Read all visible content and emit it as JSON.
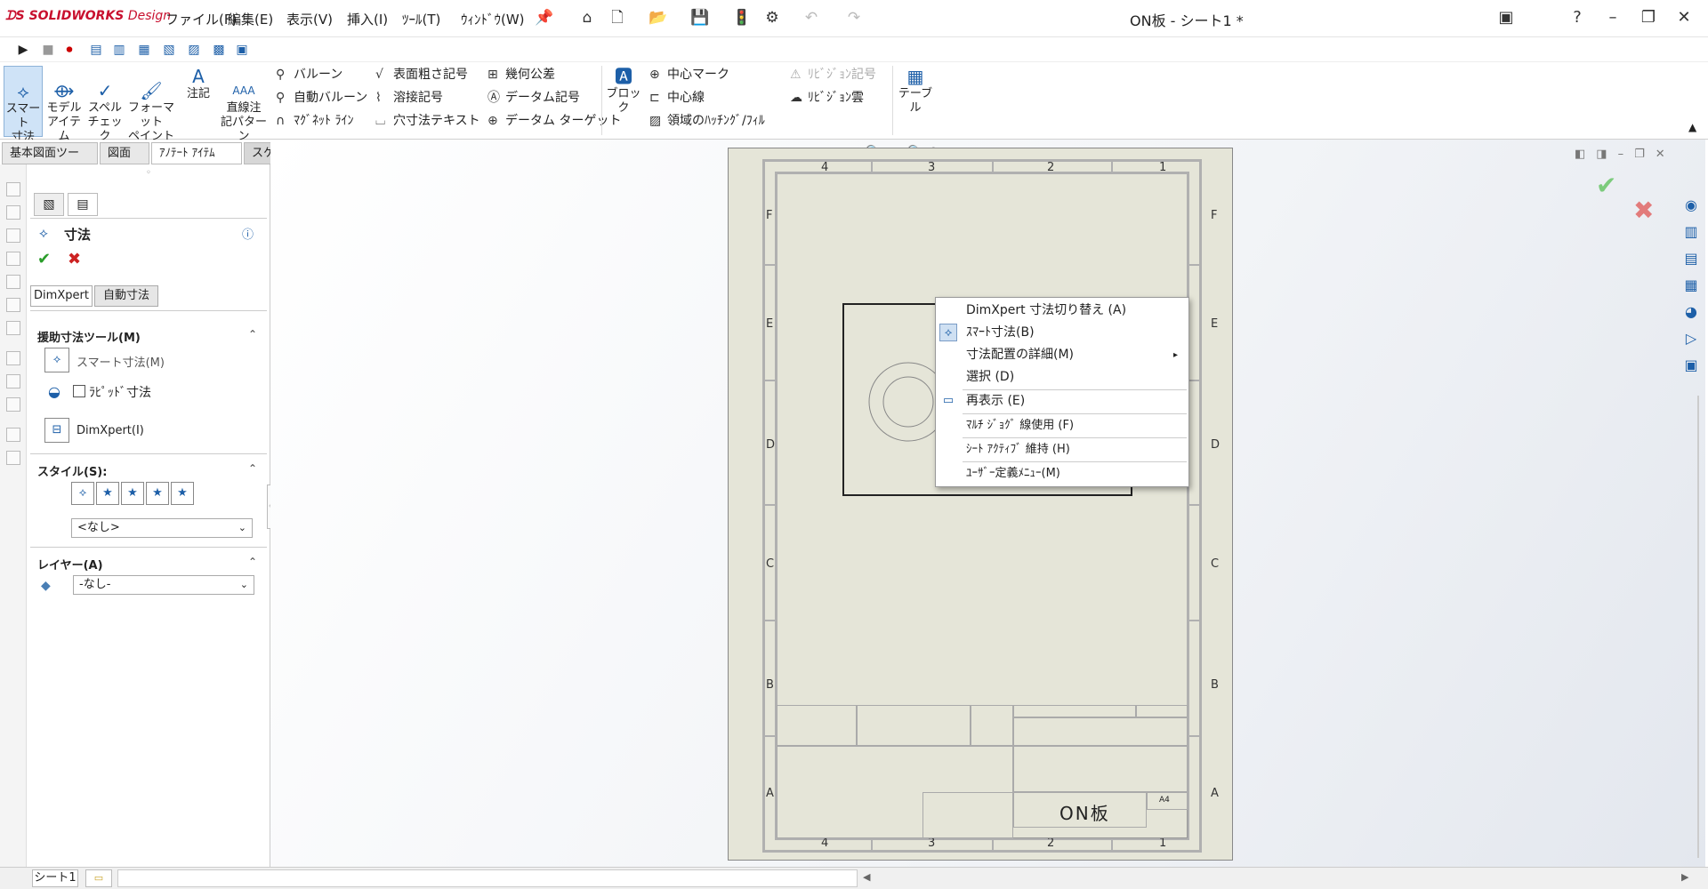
{
  "app": {
    "brand_prefix": "SOLIDWORKS",
    "brand_suffix": "Design",
    "doc_title": "ON板 - シート1 *"
  },
  "menu": [
    "ファイル(F)",
    "編集(E)",
    "表示(V)",
    "挿入(I)",
    "ﾂｰﾙ(T)",
    "ｳｨﾝﾄﾞｳ(W)"
  ],
  "ribbon": {
    "smart_dim": "スマート\n寸法",
    "model_items": "モデル\nアイテム",
    "spell_check": "スペル\nチェック",
    "format_paint": "フォーマット\nペイント",
    "note": "注記",
    "linear_note": "直線注\n記パターン",
    "balloon": "バルーン",
    "auto_balloon": "自動バルーン",
    "magnetic_line": "ﾏｸﾞﾈｯﾄ ﾗｲﾝ",
    "surface_finish": "表面粗さ記号",
    "weld_symbol": "溶接記号",
    "hole_callout": "穴寸法テキスト",
    "gtol": "幾何公差",
    "datum_feature": "データム記号",
    "datum_target": "データム ターゲット",
    "block": "ブロック",
    "center_mark": "中心マーク",
    "centerline": "中心線",
    "area_hatch": "領域のﾊｯﾁﾝｸﾞ/ﾌｨﾙ",
    "revision_symbol": "ﾘﾋﾞｼﾞｮﾝ記号",
    "revision_cloud": "ﾘﾋﾞｼﾞｮﾝ雲",
    "table": "テーブル"
  },
  "tabs": [
    "基本図面ツール",
    "図面",
    "ｱﾉﾃｰﾄ ｱｲﾃﾑ",
    "スケッチ"
  ],
  "panel": {
    "title": "寸法",
    "tab_dimxpert": "DimXpert",
    "tab_auto": "自動寸法",
    "assist_header": "援助寸法ツール(M)",
    "smart_dim": "スマート寸法(M)",
    "rapid_dim": "ﾗﾋﾟｯﾄﾞ寸法",
    "dimxpert": "DimXpert(I)",
    "style_header": "スタイル(S):",
    "style_value": "<なし>",
    "layer_header": "レイヤー(A)",
    "layer_value": "-なし-"
  },
  "sheet": {
    "zones_top": [
      "4",
      "3",
      "2",
      "1"
    ],
    "zones_side": [
      "F",
      "E",
      "D",
      "C",
      "B",
      "A"
    ],
    "part_name": "ON板",
    "size": "A4"
  },
  "context_menu": [
    "DimXpert 寸法切り替え (A)",
    "ｽﾏｰﾄ寸法(B)",
    "寸法配置の詳細(M)",
    "選択 (D)",
    "再表示 (E)",
    "ﾏﾙﾁ ｼﾞｮｸﾞ 線使用 (F)",
    "ｼｰﾄ ｱｸﾃｨﾌﾞ 維持 (H)",
    "ﾕｰｻﾞｰ定義ﾒﾆｭｰ(M)"
  ],
  "status": {
    "sheet_tab": "シート1"
  },
  "colors": {
    "brand": "#c8102e",
    "accept": "#2a9d2a",
    "cancel": "#cc2222",
    "sheet": "#e5e5d8"
  }
}
